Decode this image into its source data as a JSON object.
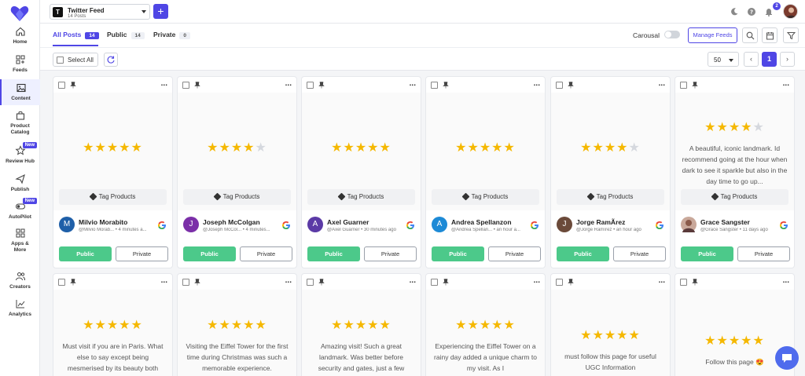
{
  "sidebar": {
    "items": [
      {
        "label": "Home",
        "icon": "home-icon"
      },
      {
        "label": "Feeds",
        "icon": "feeds-icon"
      },
      {
        "label": "Content",
        "icon": "image-icon"
      },
      {
        "label": "Product Catalog",
        "icon": "bag-icon"
      },
      {
        "label": "Review Hub",
        "icon": "star-icon",
        "badge": "New"
      },
      {
        "label": "Publish",
        "icon": "send-icon"
      },
      {
        "label": "AutoPilot",
        "icon": "toggle-icon",
        "badge": "New"
      },
      {
        "label": "Apps & More",
        "icon": "grid-icon"
      },
      {
        "label": "Creators",
        "icon": "users-icon"
      },
      {
        "label": "Analytics",
        "icon": "chart-icon"
      }
    ]
  },
  "header": {
    "feed_initial": "T",
    "feed_name": "Twitter Feed",
    "feed_count": "14 Posts",
    "add_label": "+",
    "notification_count": "2"
  },
  "tabs": [
    {
      "label": "All Posts",
      "count": "14"
    },
    {
      "label": "Public",
      "count": "14"
    },
    {
      "label": "Private",
      "count": "0"
    }
  ],
  "controls": {
    "carousal_label": "Carousal",
    "manage_feeds_label": "Manage Feeds",
    "select_all_label": "Select All",
    "per_page": "50",
    "current_page": "1",
    "prev_label": "‹",
    "next_label": "›"
  },
  "card_labels": {
    "tag_products": "Tag Products",
    "public": "Public",
    "private": "Private",
    "more": "..."
  },
  "colors": {
    "accent": "#4f46e5",
    "public_green": "#4cc98a",
    "star": "#f5b800"
  },
  "cards_row1": [
    {
      "rating": 5,
      "text": "",
      "author": "Milvio Morabito",
      "meta": "@Milvio Morab... • 4 minutes a...",
      "initial": "M",
      "avatar_color": "#1f5fa8"
    },
    {
      "rating": 4,
      "text": "",
      "author": "Joseph McColgan",
      "meta": "@Joseph McCol... • 4 minutes...",
      "initial": "J",
      "avatar_color": "#7b2fa8"
    },
    {
      "rating": 5,
      "text": "",
      "author": "Axel Guarner",
      "meta": "@Axel Guarner • 30 minutes ago",
      "initial": "A",
      "avatar_color": "#5b3aa6"
    },
    {
      "rating": 5,
      "text": "",
      "author": "Andrea Spellanzon",
      "meta": "@Andrea Spellan... • an hour a...",
      "initial": "A",
      "avatar_color": "#1d8ad6"
    },
    {
      "rating": 4,
      "text": "",
      "author": "Jorge RamÃrez",
      "meta": "@Jorge Ramírez • an hour ago",
      "initial": "J",
      "avatar_color": "#6b4a3a"
    },
    {
      "rating": 4,
      "text": "A beautiful, iconic landmark. Id recommend going at the hour when dark to see it sparkle but also in the day time to go up...",
      "author": "Grace Sangster",
      "meta": "@Grace Sangster • 11 days ago",
      "initial": "",
      "avatar_color": "#c9a89a"
    }
  ],
  "cards_row2": [
    {
      "rating": 5,
      "text": "Must visit if you are in Paris. What else to say except being mesmerised by its beauty both"
    },
    {
      "rating": 5,
      "text": "Visiting the Eiffel Tower for the first time during Christmas was such a memorable experience."
    },
    {
      "rating": 5,
      "text": "Amazing visit! Such a great landmark. Was better before security and gates, just a few"
    },
    {
      "rating": 5,
      "text": "Experiencing the Eiffel Tower on a rainy day added a unique charm to my visit. As I"
    },
    {
      "rating": 5,
      "text": "must follow this page for useful UGC Information"
    },
    {
      "rating": 5,
      "text": "Follow this page 😍"
    }
  ]
}
